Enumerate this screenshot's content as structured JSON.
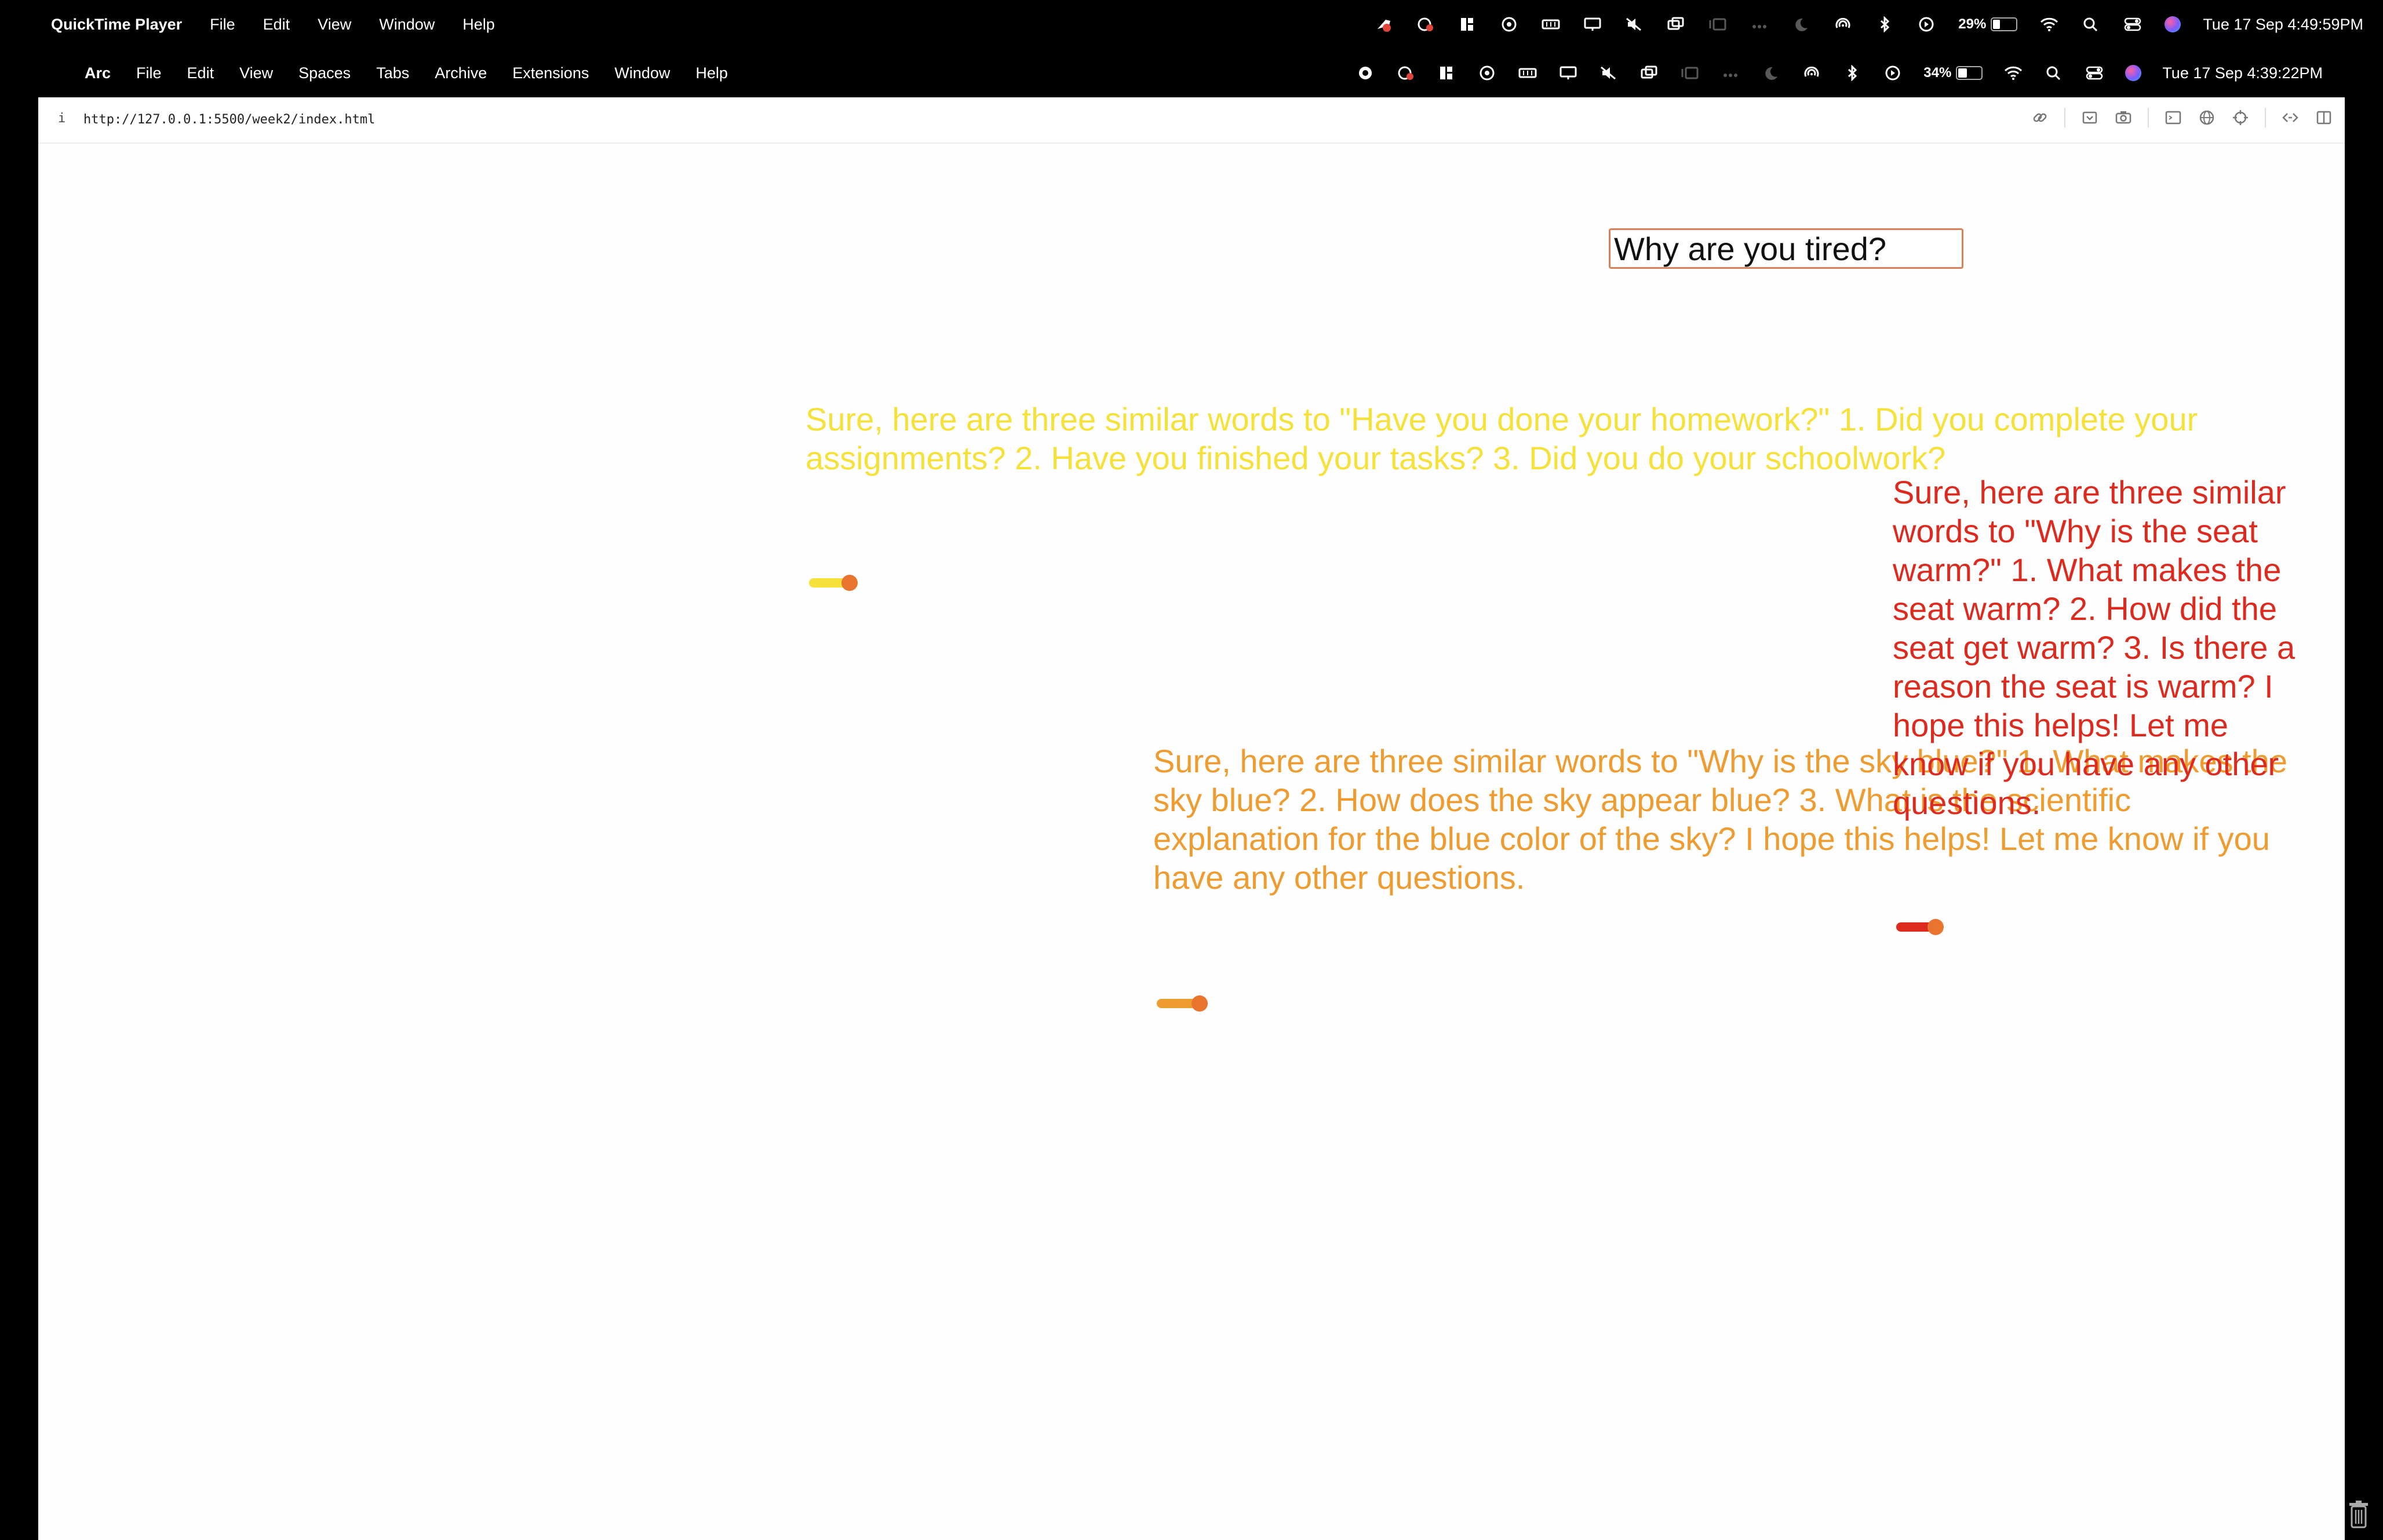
{
  "outer_menubar": {
    "app_name": "QuickTime Player",
    "menus": [
      "File",
      "Edit",
      "View",
      "Window",
      "Help"
    ],
    "battery_percent": "29%",
    "datetime": "Tue 17 Sep  4:49:59PM"
  },
  "inner_menubar": {
    "app_name": "Arc",
    "menus": [
      "File",
      "Edit",
      "View",
      "Spaces",
      "Tabs",
      "Archive",
      "Extensions",
      "Window",
      "Help"
    ],
    "battery_percent": "34%",
    "datetime": "Tue 17 Sep  4:39:22PM"
  },
  "browser": {
    "info_icon_label": "i",
    "url": "http://127.0.0.1:5500/week2/index.html"
  },
  "page": {
    "question_input_value": "Why are you tired?",
    "answers": [
      {
        "color": "#f5e13a",
        "text": "Sure, here are three similar words to \"Have you done your homework?\" 1. Did you complete your assignments? 2. Have you finished your tasks? 3. Did you do your schoolwork?"
      },
      {
        "color": "#ee9b30",
        "text": "Sure, here are three similar words to \"Why is the sky blue?\" 1. What makes the sky blue? 2. How does the sky appear blue? 3. What is the scientific explanation for the blue color of the sky? I hope this helps! Let me know if you have any other questions."
      },
      {
        "color": "#dd2a1f",
        "text": "Sure, here are three similar words to \"Why is the seat warm?\" 1. What makes the seat warm? 2. How did the seat get warm? 3. Is there a reason the seat is warm? I hope this helps! Let me know if you have any other questions."
      }
    ]
  }
}
